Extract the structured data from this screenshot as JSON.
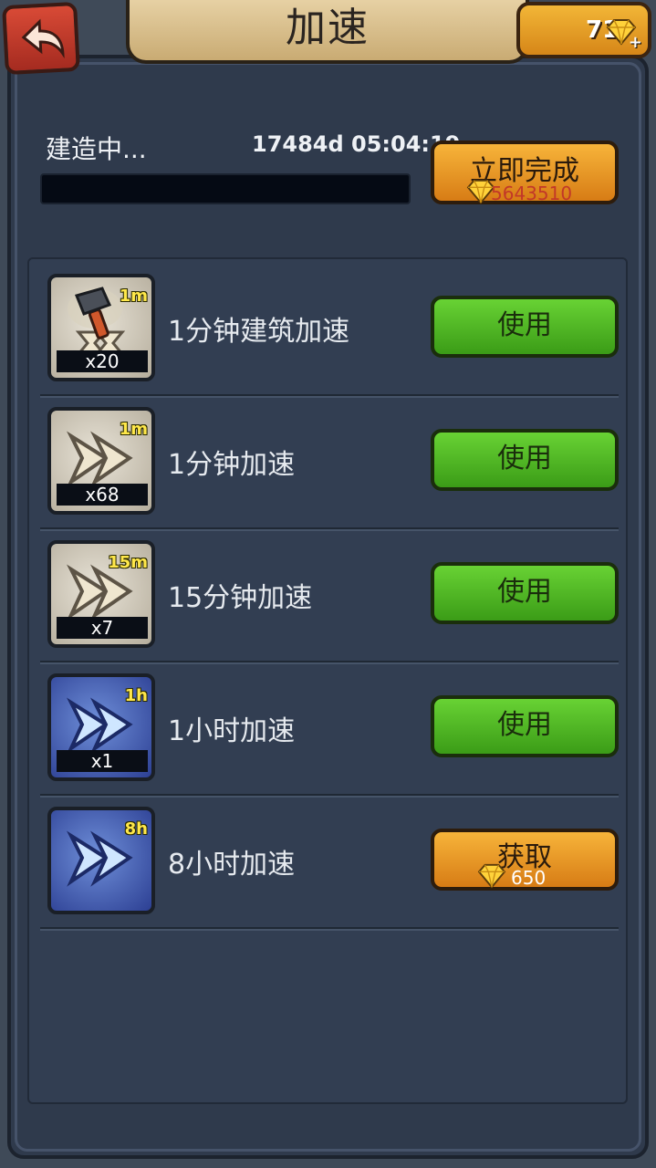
{
  "header": {
    "title": "加速",
    "gem_count": "71"
  },
  "progress": {
    "status_label": "建造中...",
    "timer": "17484d 05:04:19",
    "fraction": 0.0
  },
  "complete_button": {
    "label": "立即完成",
    "cost": "5643510"
  },
  "items": [
    {
      "name": "1分钟建筑加速",
      "duration": "1m",
      "quantity": "x20",
      "button": "使用",
      "cost": ""
    },
    {
      "name": "1分钟加速",
      "duration": "1m",
      "quantity": "x68",
      "button": "使用",
      "cost": ""
    },
    {
      "name": "15分钟加速",
      "duration": "15m",
      "quantity": "x7",
      "button": "使用",
      "cost": ""
    },
    {
      "name": "1小时加速",
      "duration": "1h",
      "quantity": "x1",
      "button": "使用",
      "cost": ""
    },
    {
      "name": "8小时加速",
      "duration": "8h",
      "quantity": "",
      "button": "获取",
      "cost": "650"
    }
  ],
  "icons": {
    "back": "back-arrow-icon",
    "gem": "gem-icon",
    "plus": "plus-icon",
    "hammer": "hammer-icon",
    "speedup": "double-arrow-icon"
  },
  "colors": {
    "green_button": "#4fb826",
    "orange_button": "#e89a22",
    "cost_red": "#c23828",
    "duration_yellow": "#ffe84a"
  }
}
